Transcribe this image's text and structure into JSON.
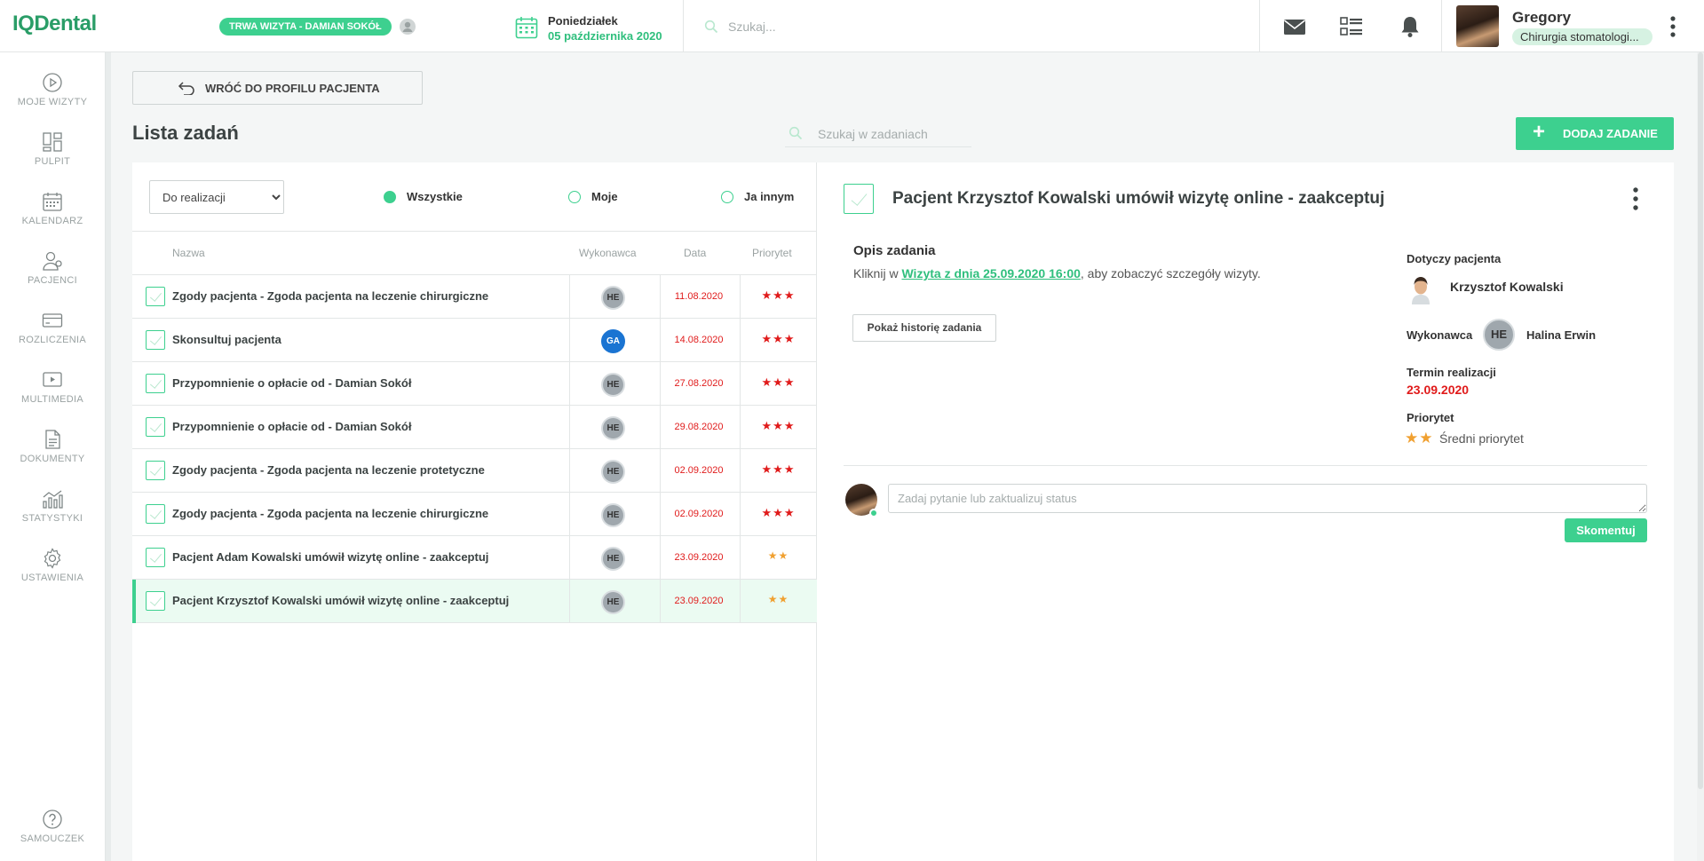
{
  "app": {
    "logo": "IQDental"
  },
  "topbar": {
    "visit_badge": "TRWA WIZYTA - DAMIAN SOKÓŁ",
    "day": "Poniedziałek",
    "date": "05 października 2020",
    "search_placeholder": "Szukaj...",
    "user_name": "Gregory",
    "user_spec": "Chirurgia stomatologi..."
  },
  "sidebar": {
    "items": [
      {
        "label": "MOJE WIZYTY",
        "icon": "play-circle-icon"
      },
      {
        "label": "PULPIT",
        "icon": "dashboard-icon"
      },
      {
        "label": "KALENDARZ",
        "icon": "calendar-icon"
      },
      {
        "label": "PACJENCI",
        "icon": "patients-icon"
      },
      {
        "label": "ROZLICZENIA",
        "icon": "credit-card-icon"
      },
      {
        "label": "MULTIMEDIA",
        "icon": "media-icon"
      },
      {
        "label": "DOKUMENTY",
        "icon": "document-icon"
      },
      {
        "label": "STATYSTYKI",
        "icon": "chart-icon"
      },
      {
        "label": "USTAWIENIA",
        "icon": "gear-icon"
      }
    ],
    "help": {
      "label": "SAMOUCZEK",
      "icon": "help-icon"
    }
  },
  "main": {
    "back_label": "WRÓĆ DO PROFILU PACJENTA",
    "title": "Lista zadań",
    "task_search_placeholder": "Szukaj w zadaniach",
    "add_label": "DODAJ ZADANIE"
  },
  "list": {
    "filter_value": "Do realizacji",
    "radios": [
      {
        "label": "Wszystkie",
        "checked": true
      },
      {
        "label": "Moje",
        "checked": false
      },
      {
        "label": "Ja innym",
        "checked": false
      }
    ],
    "headers": {
      "name": "Nazwa",
      "executor": "Wykonawca",
      "date": "Data",
      "priority": "Priorytet"
    },
    "rows": [
      {
        "name": "Zgody pacjenta - Zgoda pacjenta na leczenie chirurgiczne",
        "executor": "HE",
        "date": "11.08.2020",
        "priority": "★★★",
        "level": "high"
      },
      {
        "name": "Skonsultuj pacjenta",
        "executor": "GA",
        "date": "14.08.2020",
        "priority": "★★★",
        "level": "high"
      },
      {
        "name": "Przypomnienie o opłacie od - Damian Sokół",
        "executor": "HE",
        "date": "27.08.2020",
        "priority": "★★★",
        "level": "high"
      },
      {
        "name": "Przypomnienie o opłacie od - Damian Sokół",
        "executor": "HE",
        "date": "29.08.2020",
        "priority": "★★★",
        "level": "high"
      },
      {
        "name": "Zgody pacjenta - Zgoda pacjenta na leczenie protetyczne",
        "executor": "HE",
        "date": "02.09.2020",
        "priority": "★★★",
        "level": "high"
      },
      {
        "name": "Zgody pacjenta - Zgoda pacjenta na leczenie chirurgiczne",
        "executor": "HE",
        "date": "02.09.2020",
        "priority": "★★★",
        "level": "high"
      },
      {
        "name": "Pacjent Adam Kowalski umówił wizytę online - zaakceptuj",
        "executor": "HE",
        "date": "23.09.2020",
        "priority": "★★",
        "level": "mid"
      },
      {
        "name": "Pacjent Krzysztof Kowalski umówił wizytę online - zaakceptuj",
        "executor": "HE",
        "date": "23.09.2020",
        "priority": "★★",
        "level": "mid"
      }
    ],
    "colors": {
      "accent": "#3dd08f",
      "danger": "#e01b1b",
      "star_mid": "#f0a030",
      "avatar_blue": "#1a74d2"
    }
  },
  "detail": {
    "title": "Pacjent Krzysztof Kowalski umówił wizytę online - zaakceptuj",
    "desc_heading": "Opis zadania",
    "desc_prefix": "Kliknij w ",
    "desc_link": "Wizyta z dnia 25.09.2020 16:00",
    "desc_suffix": ", aby zobaczyć szczegóły wizyty.",
    "history_button": "Pokaż historię zadania",
    "patient_label": "Dotyczy pacjenta",
    "patient_name": "Krzysztof Kowalski",
    "executor_label": "Wykonawca",
    "executor_initials": "HE",
    "executor_name": "Halina Erwin",
    "term_label": "Termin realizacji",
    "term_value": "23.09.2020",
    "priority_label": "Priorytet",
    "priority_stars": "★★",
    "priority_value": "Średni priorytet",
    "comment_placeholder": "Zadaj pytanie lub zaktualizuj status",
    "send_label": "Skomentuj"
  }
}
